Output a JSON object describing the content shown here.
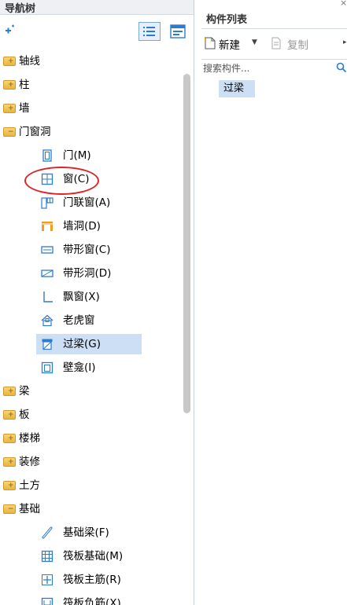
{
  "left_panel": {
    "title": "导航树",
    "tree": [
      {
        "label": "轴线",
        "kind": "folder"
      },
      {
        "label": "柱",
        "kind": "folder"
      },
      {
        "label": "墙",
        "kind": "folder"
      },
      {
        "label": "门窗洞",
        "kind": "folder-open"
      },
      {
        "label": "门(M)",
        "kind": "door-icon"
      },
      {
        "label": "窗(C)",
        "kind": "window-icon"
      },
      {
        "label": "门联窗(A)",
        "kind": "door-window-icon"
      },
      {
        "label": "墙洞(D)",
        "kind": "wall-opening-icon"
      },
      {
        "label": "带形窗(C)",
        "kind": "strip-window-icon"
      },
      {
        "label": "带形洞(D)",
        "kind": "strip-opening-icon"
      },
      {
        "label": "飘窗(X)",
        "kind": "bay-window-icon"
      },
      {
        "label": "老虎窗",
        "kind": "dormer-window-icon"
      },
      {
        "label": "过梁(G)",
        "kind": "lintel-icon",
        "selected": true
      },
      {
        "label": "壁龛(I)",
        "kind": "niche-icon"
      },
      {
        "label": "梁",
        "kind": "folder"
      },
      {
        "label": "板",
        "kind": "folder"
      },
      {
        "label": "楼梯",
        "kind": "folder"
      },
      {
        "label": "装修",
        "kind": "folder"
      },
      {
        "label": "土方",
        "kind": "folder"
      },
      {
        "label": "基础",
        "kind": "folder-open"
      },
      {
        "label": "基础梁(F)",
        "kind": "foundation-beam-icon"
      },
      {
        "label": "筏板基础(M)",
        "kind": "raft-foundation-icon"
      },
      {
        "label": "筏板主筋(R)",
        "kind": "raft-main-rebar-icon"
      },
      {
        "label": "筏板负筋(X)",
        "kind": "raft-negative-rebar-icon"
      }
    ]
  },
  "right_panel": {
    "title": "构件列表",
    "toolbar": {
      "new_label": "新建",
      "copy_label": "复制"
    },
    "search": {
      "placeholder": "搜索构件..."
    },
    "items": [
      "过梁"
    ]
  },
  "colors": {
    "selection": "#cddff4",
    "highlight_ring": "#e0232b",
    "folder": "#e9b43f"
  }
}
